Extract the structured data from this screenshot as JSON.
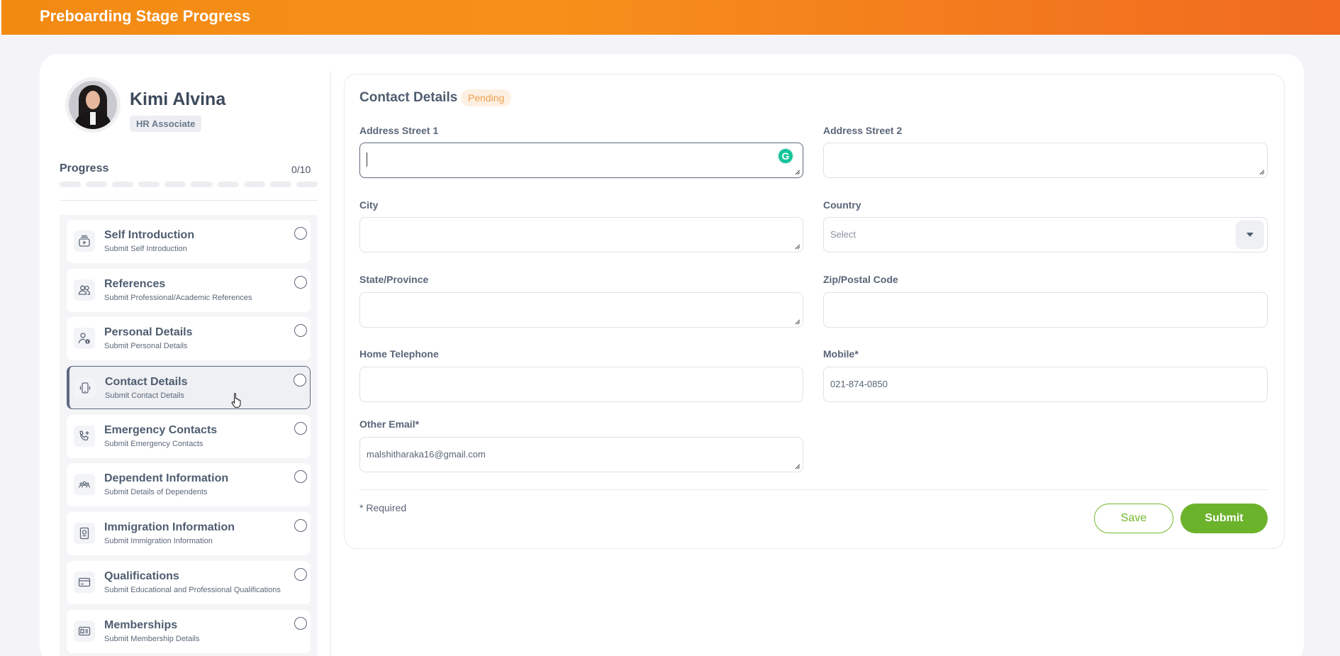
{
  "header": {
    "title": "Preboarding Stage Progress"
  },
  "profile": {
    "name": "Kimi Alvina",
    "role": "HR Associate"
  },
  "progress": {
    "label": "Progress",
    "count": "0/10",
    "completed_fraction": 0.0
  },
  "steps": [
    {
      "title": "Self Introduction",
      "subtitle": "Submit Self Introduction",
      "icon": "video-icon"
    },
    {
      "title": "References",
      "subtitle": "Submit Professional/Academic References",
      "icon": "people-icon"
    },
    {
      "title": "Personal Details",
      "subtitle": "Submit Personal Details",
      "icon": "user-info-icon"
    },
    {
      "title": "Contact Details",
      "subtitle": "Submit Contact Details",
      "icon": "mobile-icon",
      "active": true
    },
    {
      "title": "Emergency Contacts",
      "subtitle": "Submit Emergency Contacts",
      "icon": "phone-add-icon"
    },
    {
      "title": "Dependent Information",
      "subtitle": "Submit Details of Dependents",
      "icon": "group-icon"
    },
    {
      "title": "Immigration Information",
      "subtitle": "Submit Immigration Information",
      "icon": "passport-icon"
    },
    {
      "title": "Qualifications",
      "subtitle": "Submit Educational and Professional Qualifications",
      "icon": "card-icon"
    },
    {
      "title": "Memberships",
      "subtitle": "Submit Membership Details",
      "icon": "id-card-icon"
    }
  ],
  "form": {
    "title": "Contact Details",
    "status": "Pending",
    "fields": {
      "address1": {
        "label": "Address Street 1",
        "value": ""
      },
      "address2": {
        "label": "Address Street 2",
        "value": ""
      },
      "city": {
        "label": "City",
        "value": ""
      },
      "country": {
        "label": "Country",
        "placeholder": "Select"
      },
      "state": {
        "label": "State/Province",
        "value": ""
      },
      "zip": {
        "label": "Zip/Postal Code",
        "value": ""
      },
      "home_phone": {
        "label": "Home Telephone",
        "value": ""
      },
      "mobile": {
        "label": "Mobile*",
        "value": "021-874-0850"
      },
      "other_email": {
        "label": "Other Email*",
        "value": "malshitharaka16@gmail.com"
      }
    },
    "required_note": "* Required",
    "save_label": "Save",
    "submit_label": "Submit"
  },
  "colors": {
    "header_start": "#f28a12",
    "header_end": "#f06a20",
    "accent_green": "#6cb32c",
    "pending": "#f0a050"
  }
}
